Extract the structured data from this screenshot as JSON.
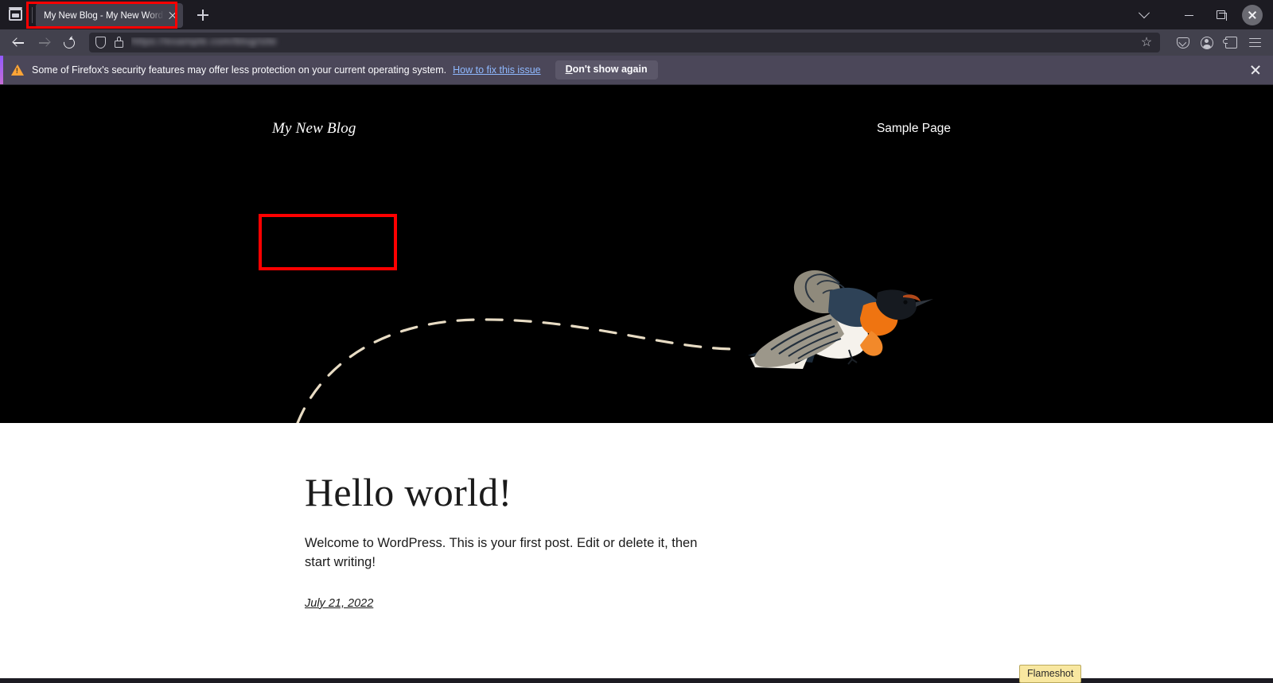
{
  "browser": {
    "firefox_view_icon": "firefox-view-icon",
    "tab": {
      "title": "My New Blog - My New WordPr",
      "close_icon": "close-icon"
    },
    "new_tab_icon": "plus-icon",
    "window_controls": {
      "list_all_tabs_icon": "chevron-down-icon",
      "minimize_icon": "minimize-icon",
      "maximize_icon": "maximize-icon",
      "close_icon": "close-icon"
    },
    "toolbar": {
      "back_icon": "arrow-left-icon",
      "forward_icon": "arrow-right-icon",
      "reload_icon": "reload-icon",
      "shield_icon": "shield-icon",
      "lock_icon": "lock-icon",
      "url_value": "https://example.com/blog/site",
      "bookmark_icon": "star-icon",
      "pocket_icon": "pocket-icon",
      "account_icon": "account-icon",
      "extensions_icon": "extensions-icon",
      "menu_icon": "hamburger-menu-icon"
    }
  },
  "notification": {
    "warning_icon": "warning-triangle-icon",
    "message": "Some of Firefox's security features may offer less protection on your current operating system.",
    "link_text": "How to fix this issue",
    "button_label": "Don't show again",
    "button_accesskey": "D",
    "button_rest": "on't show again",
    "close_icon": "close-icon",
    "accent_color": "#9059ff",
    "background_color": "#4b4759"
  },
  "page": {
    "hero_background": "#000000",
    "site_title": "My New Blog",
    "nav": [
      {
        "label": "Sample Page"
      }
    ],
    "hero_art": {
      "description": "bird-flight-illustration",
      "trail_color": "#e8dcc4"
    },
    "post": {
      "title": "Hello world!",
      "body": "Welcome to WordPress. This is your first post. Edit or delete it, then start writing!",
      "date": "July 21, 2022"
    }
  },
  "overlay": {
    "flameshot_label": "Flameshot",
    "highlight_color": "#ff0000"
  }
}
